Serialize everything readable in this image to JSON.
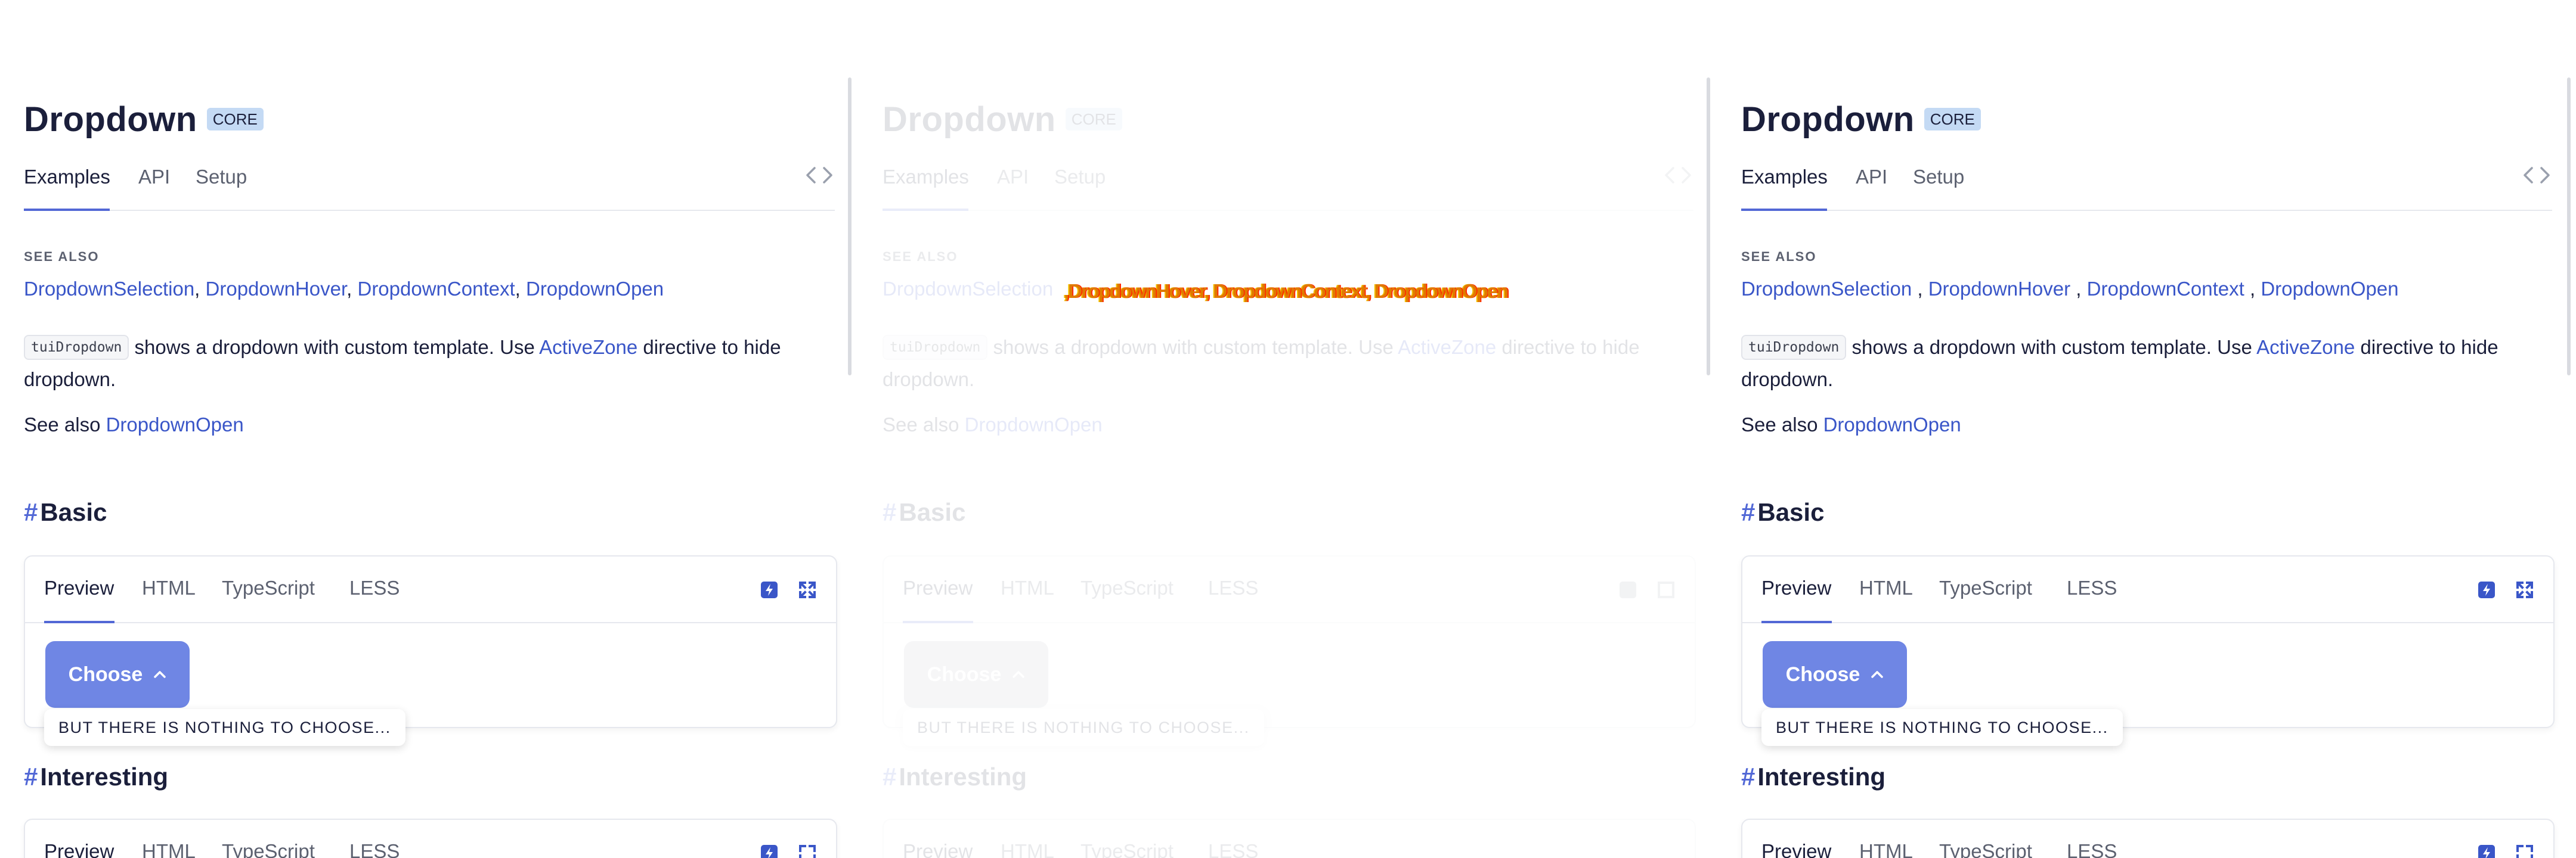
{
  "page": {
    "title": "Dropdown",
    "badge": "CORE",
    "tabs": [
      "Examples",
      "API",
      "Setup"
    ],
    "see_also_label": "SEE ALSO",
    "see_also_links": [
      "DropdownSelection",
      "DropdownHover",
      "DropdownContext",
      "DropdownOpen"
    ],
    "description": {
      "code_chip": "tuiDropdown",
      "text_before_link": " shows a dropdown with custom template. Use ",
      "link": "ActiveZone",
      "text_after_link": " directive to hide dropdown."
    },
    "see_also_line": {
      "prefix": "See also ",
      "link": "DropdownOpen"
    },
    "sections": [
      {
        "hash": "#",
        "title": "Basic",
        "tabs": [
          "Preview",
          "HTML",
          "TypeScript",
          "LESS"
        ],
        "button_label": "Choose",
        "popup_text": "BUT THERE IS NOTHING TO CHOOSE..."
      },
      {
        "hash": "#",
        "title": "Interesting",
        "tabs": [
          "Preview",
          "HTML",
          "TypeScript",
          "LESS"
        ]
      }
    ]
  },
  "glitch_overlay_text": ",DropdownHover, DropdownContext, DropdownOpen",
  "icons": {
    "code_toggle": "code-brackets-icon",
    "stackblitz": "stackblitz-icon",
    "expand": "expand-icon",
    "chevron": "chevron-up-icon"
  },
  "colors": {
    "accent": "#5268d6",
    "link": "#3a56c8",
    "button": "#6f86e4",
    "badge": "#c4daf4",
    "text": "#1b1f3b",
    "muted": "#5c6170"
  }
}
